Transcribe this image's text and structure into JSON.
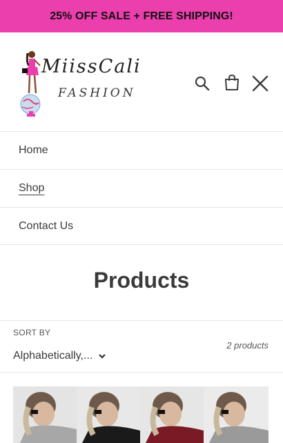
{
  "announcement": {
    "text": "25% OFF SALE + FREE SHIPPING!"
  },
  "header": {
    "logo_line1": "MiissCali",
    "logo_line2": "FASHION",
    "icons": [
      "search-icon",
      "cart-icon",
      "close-icon"
    ]
  },
  "nav": {
    "items": [
      {
        "label": "Home"
      },
      {
        "label": "Shop"
      },
      {
        "label": "Contact Us"
      }
    ],
    "active_index": 1
  },
  "main": {
    "title": "Products",
    "sort": {
      "label": "SORT BY",
      "value": "Alphabetically,..."
    },
    "count": "2 products"
  },
  "colors": {
    "announcement_bg": "#ec3fae",
    "text": "#3a3a3a",
    "border": "#e6e6e6"
  }
}
